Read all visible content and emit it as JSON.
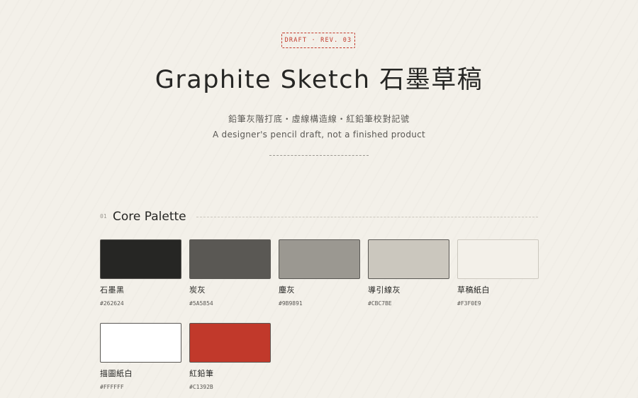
{
  "header": {
    "tag": "DRAFT · REV. 03",
    "title": "Graphite Sketch 石墨草稿",
    "subtitle_zh": "鉛筆灰階打底・虛線構造線・紅鉛筆校對記號",
    "subtitle_en": "A designer's pencil draft, not a finished product"
  },
  "section": {
    "number": "01",
    "title": "Core Palette"
  },
  "colors": {
    "accent": "#C1392B",
    "background": "#F3F0E9",
    "text": "#262624"
  },
  "palette": [
    {
      "name": "石墨黑",
      "hex": "#262624"
    },
    {
      "name": "炭灰",
      "hex": "#5A5854"
    },
    {
      "name": "塵灰",
      "hex": "#9B9891"
    },
    {
      "name": "導引線灰",
      "hex": "#CBC7BE"
    },
    {
      "name": "草稿紙白",
      "hex": "#F3F0E9"
    },
    {
      "name": "描圖紙白",
      "hex": "#FFFFFF"
    },
    {
      "name": "紅鉛筆",
      "hex": "#C1392B"
    }
  ]
}
